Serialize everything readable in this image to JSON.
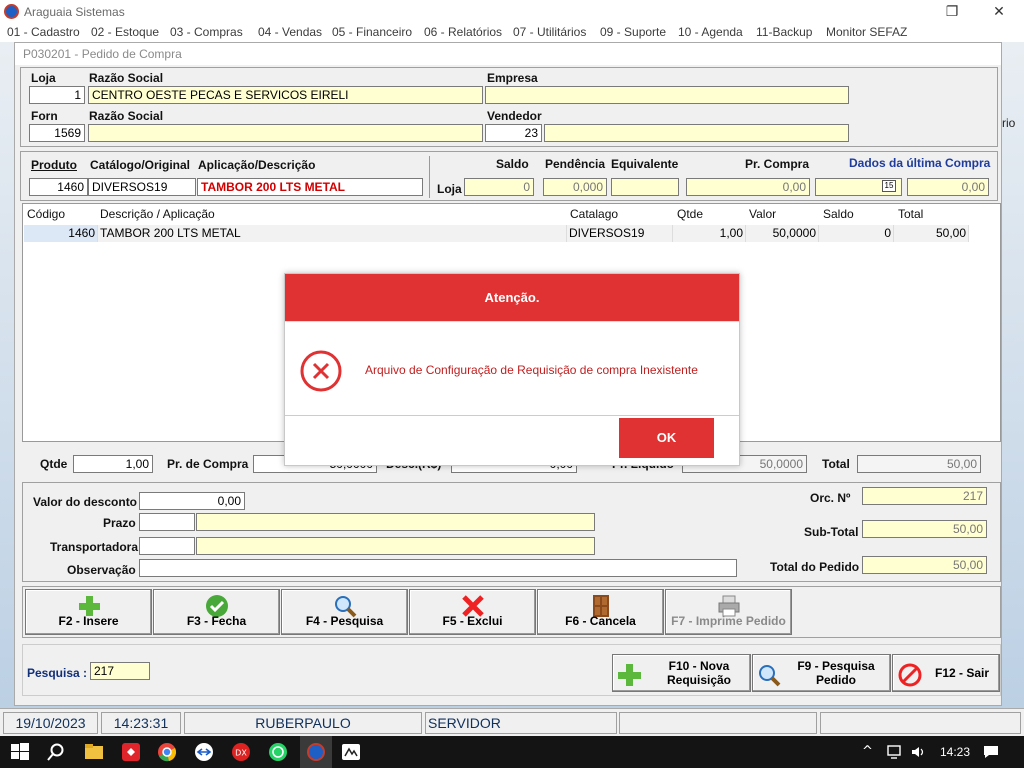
{
  "app": {
    "title": "Araguaia Sistemas",
    "menu": [
      "01 - Cadastro",
      "02 - Estoque",
      "03 - Compras",
      "04 - Vendas",
      "05 - Financeiro",
      "06 - Relatórios",
      "07 - Utilitários",
      "09 - Suporte",
      "10 - Agenda",
      "11-Backup",
      "Monitor SEFAZ"
    ],
    "background_text": "rio"
  },
  "window": {
    "title": "P030201 - Pedido de Compra"
  },
  "header": {
    "loja_label": "Loja",
    "loja_value": "1",
    "razao_label": "Razão Social",
    "razao_value": "CENTRO OESTE PECAS E SERVICOS EIRELI",
    "empresa_label": "Empresa",
    "empresa_value": "",
    "forn_label": "Forn",
    "forn_value": "1569",
    "razao2_label": "Razão Social",
    "razao2_value": "",
    "vendedor_label": "Vendedor",
    "vendedor_value": "23",
    "vendedor_name": ""
  },
  "product": {
    "produto_label": "Produto",
    "catalogo_label": "Catálogo/Original",
    "aplicacao_label": "Aplicação/Descrição",
    "produto_value": "1460",
    "catalogo_value": "DIVERSOS19",
    "aplicacao_value": "TAMBOR 200 LTS METAL",
    "saldo_label": "Saldo",
    "pendencia_label": "Pendência",
    "equivalente_label": "Equivalente",
    "prcompra_label": "Pr. Compra",
    "ultima_label": "Dados da última Compra",
    "loja_label": "Loja",
    "saldo_value": "0",
    "pendencia_value": "0,000",
    "equivalente_value": "",
    "prcompra_value": "0,00",
    "ultima_date": "",
    "ultima_value": "0,00"
  },
  "grid": {
    "headers": [
      "Código",
      "Descrição / Aplicação",
      "Catalago",
      "Qtde",
      "Valor",
      "Saldo",
      "Total"
    ],
    "rows": [
      [
        "1460",
        "TAMBOR 200 LTS METAL",
        "DIVERSOS19",
        "1,00",
        "50,0000",
        "0",
        "50,00"
      ]
    ]
  },
  "entry": {
    "qtde_label": "Qtde",
    "qtde_value": "1,00",
    "prcompra_label": "Pr. de Compra",
    "prcompra_value": "50,0000",
    "desc_label": "Desc.(R$)",
    "desc_value": "0,00",
    "liquido_label": "Pr. Líquido",
    "liquido_value": "50,0000",
    "total_label": "Total",
    "total_value": "50,00"
  },
  "footer": {
    "desconto_label": "Valor do desconto",
    "desconto_value": "0,00",
    "prazo_label": "Prazo",
    "transp_label": "Transportadora",
    "obs_label": "Observação",
    "orc_label": "Orc. Nº",
    "orc_value": "217",
    "subtotal_label": "Sub-Total",
    "subtotal_value": "50,00",
    "totalpedido_label": "Total do Pedido",
    "totalpedido_value": "50,00"
  },
  "buttons": {
    "insere": "F2 - Insere",
    "fecha": "F3 - Fecha",
    "pesquisa": "F4 - Pesquisa",
    "exclui": "F5 - Exclui",
    "cancela": "F6 - Cancela",
    "imprime": "F7 - Imprime Pedido",
    "nova_req_1": "F10 - Nova",
    "nova_req_2": "Requisição",
    "pesq_ped_1": "F9 - Pesquisa",
    "pesq_ped_2": "Pedido",
    "sair": "F12 - Sair"
  },
  "search": {
    "label": "Pesquisa :",
    "value": "217"
  },
  "status": {
    "date": "19/10/2023",
    "time": "14:23:31",
    "user": "RUBERPAULO",
    "server": "SERVIDOR"
  },
  "modal": {
    "title": "Atenção.",
    "message": "Arquivo de Configuração de Requisição de compra Inexistente",
    "ok": "OK"
  },
  "taskbar": {
    "clock": "14:23"
  },
  "colors": {
    "modal_red": "#e03232",
    "yellow_field": "#ffffd2",
    "status_text": "#10305c"
  }
}
